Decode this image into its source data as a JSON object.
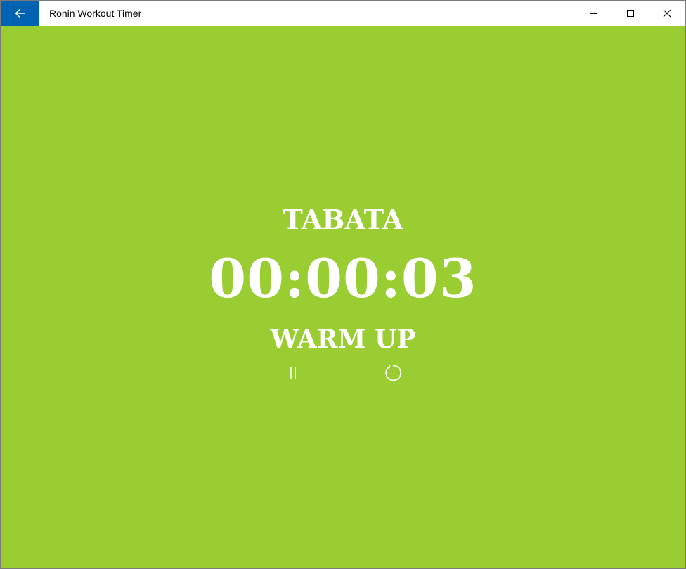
{
  "window": {
    "title": "Ronin Workout Timer",
    "back_icon": "arrow-left-icon",
    "caption_icons": [
      "minimize-icon",
      "maximize-icon",
      "close-icon"
    ],
    "accent_color": "#0063B1"
  },
  "timer": {
    "mode": "TABATA",
    "time": "00:00:03",
    "phase": "WARM UP",
    "background_color": "#9ACD32",
    "text_color": "#FFFFFF"
  },
  "controls": {
    "pause_icon": "pause-icon",
    "restart_icon": "restart-icon"
  }
}
